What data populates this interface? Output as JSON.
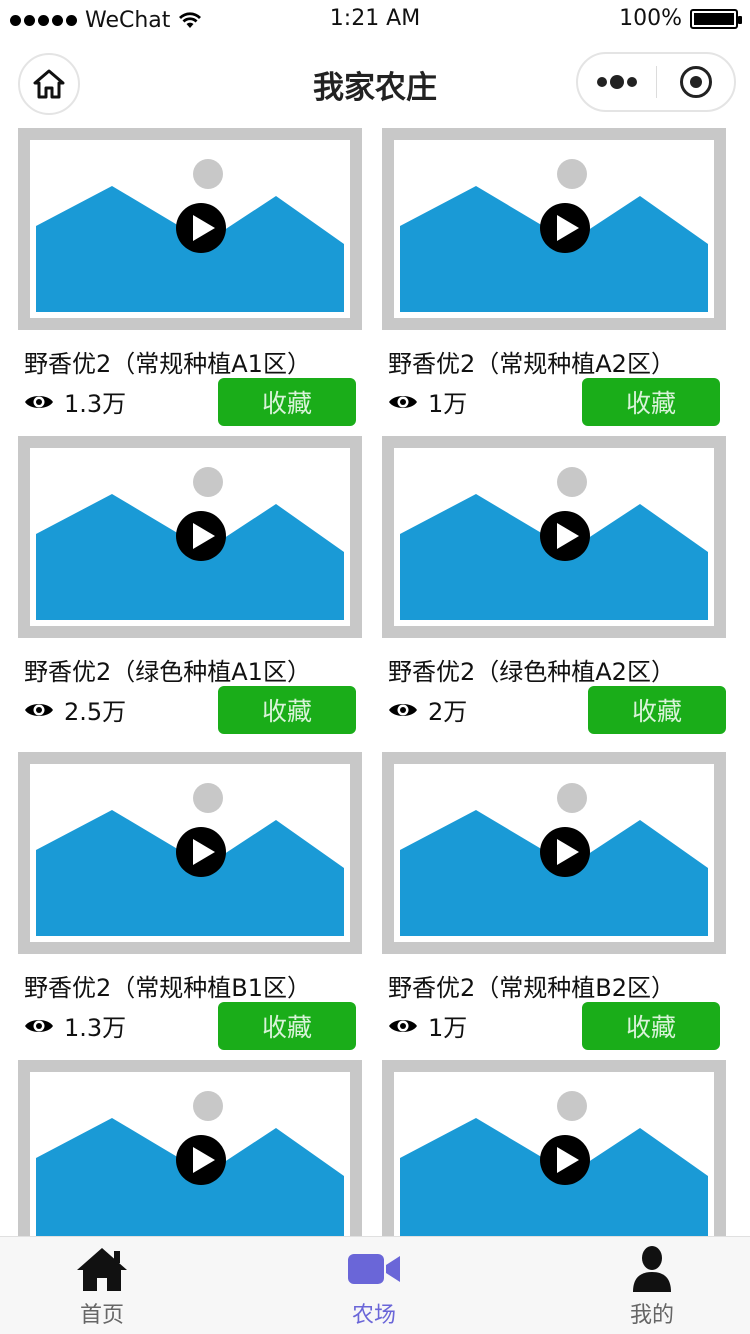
{
  "status_bar": {
    "carrier": "WeChat",
    "time": "1:21 AM",
    "battery": "100%"
  },
  "nav": {
    "title": "我家农庄"
  },
  "cards": [
    {
      "title": "野香优2（常规种植A1区）",
      "views": "1.3万",
      "fav_label": "收藏"
    },
    {
      "title": "野香优2（常规种植A2区）",
      "views": "1万",
      "fav_label": "收藏"
    },
    {
      "title": "野香优2（绿色种植A1区）",
      "views": "2.5万",
      "fav_label": "收藏"
    },
    {
      "title": "野香优2（绿色种植A2区）",
      "views": "2万",
      "fav_label": "收藏"
    },
    {
      "title": "野香优2（常规种植B1区）",
      "views": "1.3万",
      "fav_label": "收藏"
    },
    {
      "title": "野香优2（常规种植B2区）",
      "views": "1万",
      "fav_label": "收藏"
    }
  ],
  "tab_bar": {
    "items": [
      {
        "label": "首页",
        "icon": "home-icon"
      },
      {
        "label": "农场",
        "icon": "video-camera-icon",
        "active": true
      },
      {
        "label": "我的",
        "icon": "user-icon"
      }
    ]
  },
  "colors": {
    "accent_active_tab": "#6a66d8",
    "favorite_button": "#1aad19",
    "thumbnail_blue": "#1a9ad6",
    "thumbnail_frame": "#c8c8c8"
  }
}
